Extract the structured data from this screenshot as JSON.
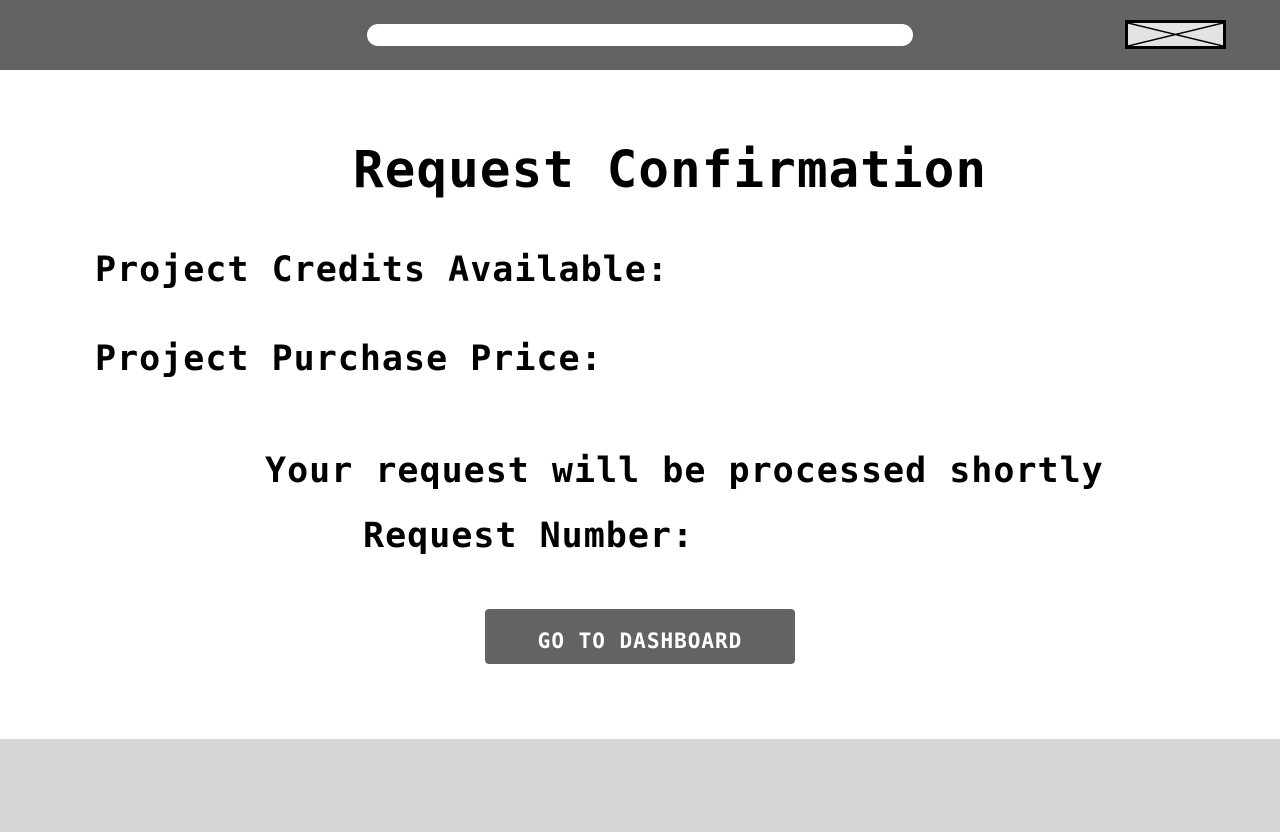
{
  "header": {
    "search": {
      "value": "",
      "placeholder": ""
    },
    "image_icon": "image-placeholder-icon"
  },
  "main": {
    "title": "Request Confirmation",
    "credits_label": "Project Credits Available:",
    "price_label": "Project Purchase Price:",
    "status_message": "Your request will be processed shortly",
    "request_number_label": "Request Number:",
    "dashboard_button_label": "GO TO DASHBOARD"
  },
  "colors": {
    "header_bg": "#636363",
    "button_bg": "#636363",
    "footer_bg": "#d6d6d6",
    "text": "#000000"
  }
}
